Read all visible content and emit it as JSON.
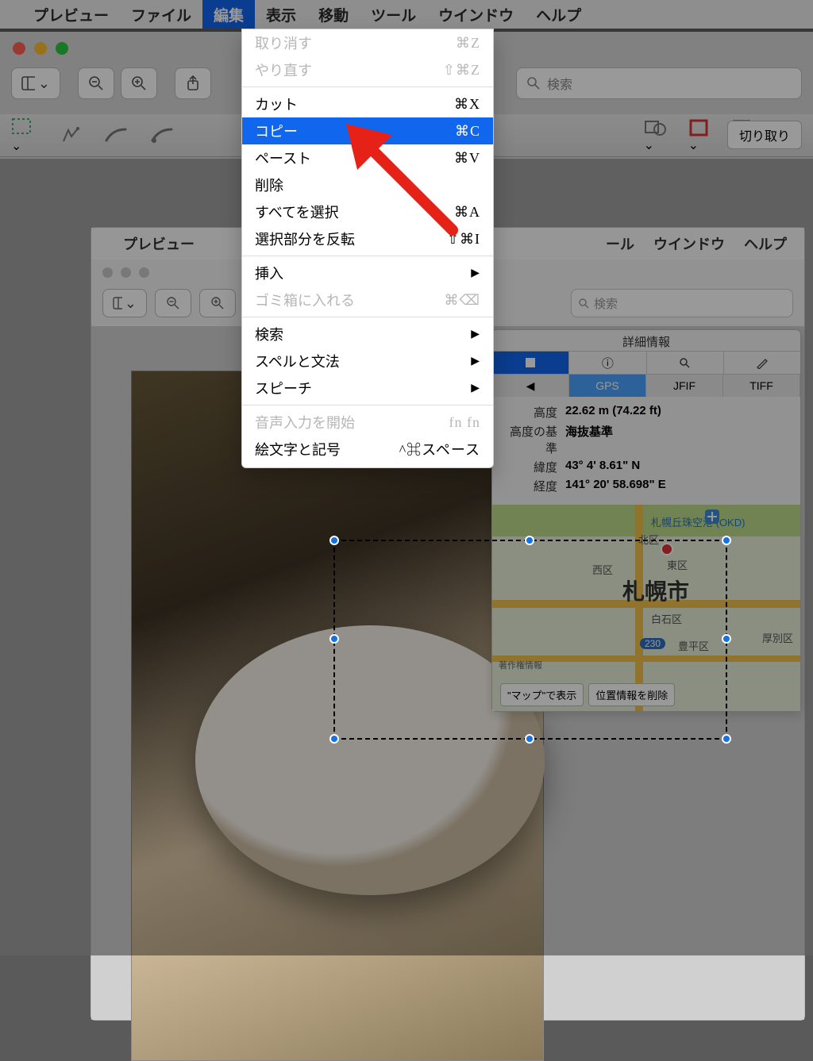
{
  "menubar": {
    "app": "プレビュー",
    "items": [
      "ファイル",
      "編集",
      "表示",
      "移動",
      "ツール",
      "ウインドウ",
      "ヘルプ"
    ],
    "highlighted_index": 1
  },
  "toolbar": {
    "search_placeholder": "検索",
    "crop_label": "切り取り"
  },
  "inner_menubar": {
    "app": "プレビュー",
    "items": [
      "ール",
      "ウインドウ",
      "ヘルプ"
    ]
  },
  "inner_toolbar": {
    "search_placeholder": "検索"
  },
  "edit_menu": {
    "items": [
      {
        "label": "取り消す",
        "shortcut": "⌘Z",
        "disabled": true
      },
      {
        "label": "やり直す",
        "shortcut": "⇧⌘Z",
        "disabled": true
      },
      {
        "sep": true
      },
      {
        "label": "カット",
        "shortcut": "⌘X"
      },
      {
        "label": "コピー",
        "shortcut": "⌘C",
        "hl": true
      },
      {
        "label": "ペースト",
        "shortcut": "⌘V"
      },
      {
        "label": "削除"
      },
      {
        "label": "すべてを選択",
        "shortcut": "⌘A"
      },
      {
        "label": "選択部分を反転",
        "shortcut": "⇧⌘I"
      },
      {
        "sep": true
      },
      {
        "label": "挿入",
        "submenu": true
      },
      {
        "label": "ゴミ箱に入れる",
        "shortcut": "⌘⌫",
        "disabled": true
      },
      {
        "sep": true
      },
      {
        "label": "検索",
        "submenu": true
      },
      {
        "label": "スペルと文法",
        "submenu": true
      },
      {
        "label": "スピーチ",
        "submenu": true
      },
      {
        "sep": true
      },
      {
        "label": "音声入力を開始",
        "shortcut": "fn fn",
        "disabled": true
      },
      {
        "label": "絵文字と記号",
        "shortcut": "^⌘スペース"
      }
    ]
  },
  "inspector": {
    "title": "詳細情報",
    "sub_tabs": [
      "GPS",
      "JFIF",
      "TIFF"
    ],
    "gps": [
      {
        "k": "高度",
        "v": "22.62 m (74.22 ft)"
      },
      {
        "k": "高度の基準",
        "v": "海抜基準"
      },
      {
        "k": "緯度",
        "v": "43° 4' 8.61\" N"
      },
      {
        "k": "経度",
        "v": "141° 20' 58.698\" E"
      }
    ],
    "copyright": "著作権情報",
    "map_buttons": [
      "\"マップ\"で表示",
      "位置情報を削除"
    ],
    "map_labels": {
      "city": "札幌市",
      "airport": "札幌丘珠空港 (OKD)",
      "kita": "北区",
      "higashi": "東区",
      "nishi": "西区",
      "shiroishi": "白石区",
      "toyohira": "豊平区",
      "atsubetsu": "厚別区",
      "route": "230"
    }
  }
}
